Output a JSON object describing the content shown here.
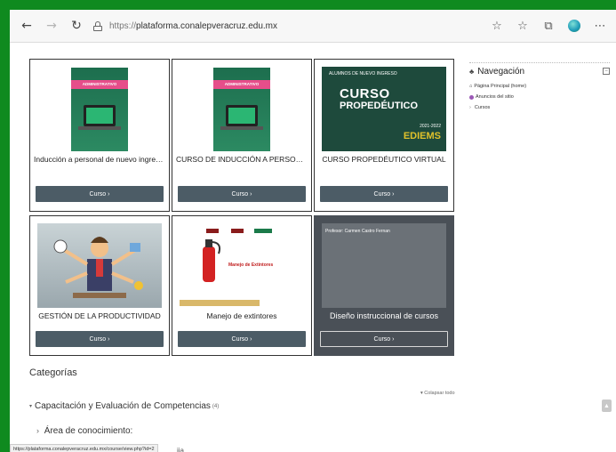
{
  "browser": {
    "url_protocol": "https://",
    "url_host": "plataforma.conalepveracruz.edu.mx"
  },
  "courses": [
    {
      "title": "Inducción a personal de nuevo ingreso...",
      "button": "Curso ›",
      "thumb_banner": "ADMINISTRATIVO"
    },
    {
      "title": "CURSO DE INDUCCIÓN A PERSONAL ...",
      "button": "Curso ›",
      "thumb_banner": "ADMINISTRATIVO"
    },
    {
      "title": "CURSO PROPEDÉUTICO VIRTUAL",
      "button": "Curso ›",
      "thumb_small": "ALUMNOS DE NUEVO INGRESO",
      "thumb_main1": "CURSO",
      "thumb_main2": "PROPEDÉUTICO",
      "thumb_year": "2021-2022",
      "thumb_brand": "EDIEMS"
    },
    {
      "title": "GESTIÓN DE LA PRODUCTIVIDAD",
      "button": "Curso ›"
    },
    {
      "title": "Manejo de extintores",
      "button": "Curso ›",
      "thumb_label": "Manejo de Extintores"
    },
    {
      "title": "Diseño instruccional de cursos",
      "button": "Curso ›",
      "profesor": "Profesor: Carmen Castro Fernan"
    }
  ],
  "sidebar": {
    "heading": "Navegación",
    "collapse_glyph": "−",
    "items": [
      {
        "label": "Página Principal (home)"
      },
      {
        "label": "Anuncios del sitio"
      },
      {
        "label": "Cursos"
      }
    ]
  },
  "categories": {
    "title": "Categorías",
    "collapse_all": "▾ Colapsar todo",
    "first": "Capacitación y Evaluación de Competencias",
    "first_count": "(4)",
    "second": "Área de conocimiento:"
  },
  "status_url": "https://plataforma.conalepveracruz.edu.mx/course/view.php?id=2",
  "status_tail": "ija",
  "colors": {
    "frame": "#0f8a1f",
    "button": "#4c5c66",
    "dark_card": "#4a5057"
  }
}
